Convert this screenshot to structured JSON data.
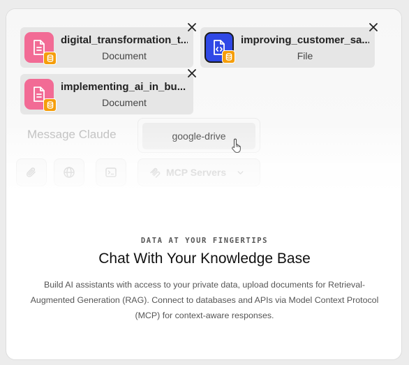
{
  "files": [
    {
      "name": "digital_transformation_t...",
      "type": "Document",
      "icon": "document-icon",
      "icon_color": "#f26b95"
    },
    {
      "name": "improving_customer_sa...",
      "type": "File",
      "icon": "file-code-icon",
      "icon_color": "#2f48e6"
    },
    {
      "name": "implementing_ai_in_bu...",
      "type": "Document",
      "icon": "document-icon",
      "icon_color": "#f26b95"
    }
  ],
  "composer": {
    "placeholder": "Message Claude",
    "suggestion": "google-drive",
    "mcp_label": "MCP Servers"
  },
  "icons": {
    "attach": "paperclip-icon",
    "web": "globe-icon",
    "terminal": "terminal-icon",
    "mcp": "mcp-icon",
    "dropdown": "chevron-down-icon",
    "close": "close-icon",
    "badge": "database-icon",
    "cursor": "hand-pointer-icon"
  },
  "colors": {
    "badge": "#f59e0b"
  },
  "feature": {
    "eyebrow": "DATA AT YOUR FINGERTIPS",
    "title": "Chat With Your Knowledge Base",
    "description": "Build AI assistants with access to your private data, upload documents for Retrieval-Augmented Generation (RAG). Connect to databases and APIs via Model Context Protocol (MCP) for context-aware responses."
  }
}
